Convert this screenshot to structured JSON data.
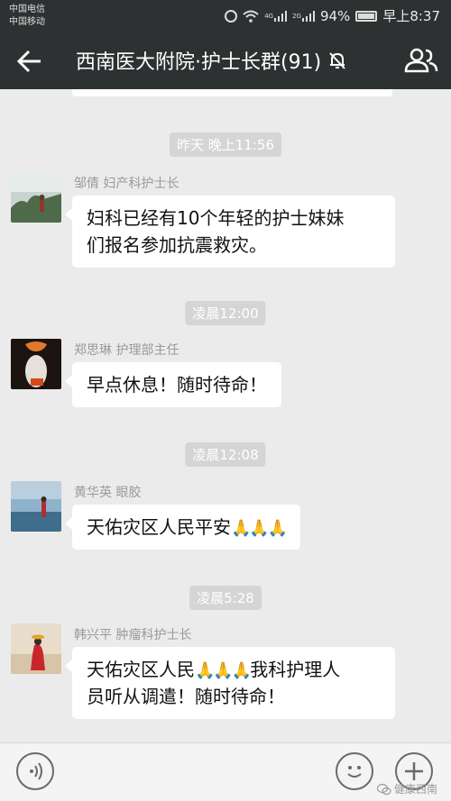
{
  "status_bar": {
    "carrier_1": "中国电信",
    "carrier_2": "中国移动",
    "net_tag_1": "4G",
    "net_tag_2": "2G",
    "battery": "94%",
    "time": "早上8:37"
  },
  "header": {
    "title": "西南医大附院·护士长群(91)"
  },
  "messages": [
    {
      "timestamp": "昨天 晚上11:56",
      "sender": "邹倩  妇产科护士长",
      "text_line1": "妇科已经有10个年轻的护士妹妹",
      "text_line2": "们报名参加抗震救灾。"
    },
    {
      "timestamp": "凌晨12:00",
      "sender": "郑思琳 护理部主任",
      "text": "早点休息！随时待命！"
    },
    {
      "timestamp": "凌晨12:08",
      "sender": "黄华英  眼胶",
      "text": "天佑灾区人民平安",
      "emoji": "🙏🙏🙏"
    },
    {
      "timestamp": "凌晨5:28",
      "sender": "韩兴平 肿瘤科护士长",
      "text_a": "天佑灾区人民",
      "emoji": "🙏🙏🙏",
      "text_b": "我科护理人",
      "text_line2": "员听从调遣！随时待命！"
    }
  ],
  "watermark": "健康西南",
  "colors": {
    "header_bg": "#2e3132",
    "chat_bg": "#ebebeb",
    "bubble_bg": "#ffffff",
    "timestamp_bg": "#d5d5d5"
  }
}
